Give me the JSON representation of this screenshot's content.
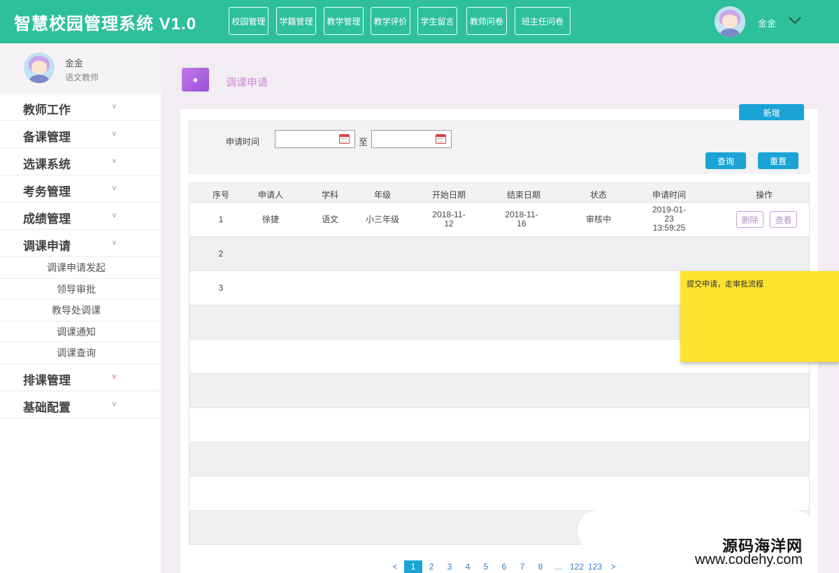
{
  "header": {
    "title": "智慧校园管理系统 V1.0",
    "nav": [
      "校园管理",
      "学籍管理",
      "教学管理",
      "教学评价",
      "学生留言",
      "教师问卷",
      "班主任问卷"
    ],
    "user": "金金"
  },
  "sidebar": {
    "profile": {
      "name": "金金",
      "role": "语文教师"
    },
    "menu": [
      "教师工作",
      "备课管理",
      "选课系统",
      "考务管理",
      "成绩管理",
      "调课申请"
    ],
    "submenu": [
      "调课申请发起",
      "领导审批",
      "教导处调课",
      "调课通知",
      "调课查询"
    ],
    "menu_after": [
      "排课管理",
      "基础配置"
    ]
  },
  "page": {
    "icon_glyph": "◆",
    "title": "调课申请",
    "add_label": "新增"
  },
  "filter": {
    "label": "申请时间",
    "to": "至",
    "start_value": "",
    "end_value": "",
    "query_label": "查询",
    "reset_label": "重置"
  },
  "table": {
    "headers": [
      "序号",
      "申请人",
      "学科",
      "年级",
      "开始日期",
      "结束日期",
      "状态",
      "申请时间",
      "操作"
    ],
    "rows": [
      {
        "no": "1",
        "applicant": "徐捷",
        "subject": "语文",
        "grade": "小三年级",
        "start": "2018-11-12",
        "end": "2018-11-16",
        "status": "审核中",
        "time": "2019-01-23 13:59:25",
        "delete": "删除",
        "view": "查看"
      },
      {
        "no": "2"
      },
      {
        "no": "3"
      }
    ]
  },
  "note": "提交申请，走审批流程",
  "pagination": [
    "<",
    "1",
    "2",
    "3",
    "4",
    "5",
    "6",
    "7",
    "8",
    "...",
    "122",
    "123",
    ">"
  ],
  "pagination_active": "1",
  "watermark": {
    "line1": "源码海洋网",
    "line2": "www.codehy.com"
  }
}
